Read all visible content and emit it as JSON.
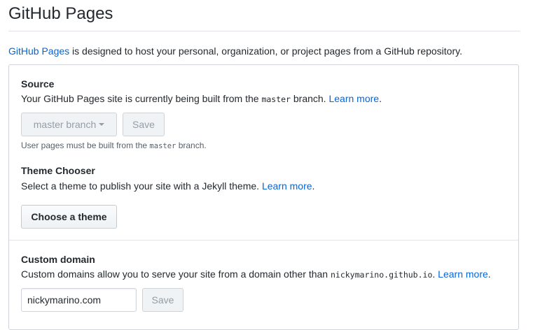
{
  "page": {
    "title": "GitHub Pages"
  },
  "intro": {
    "link": "GitHub Pages",
    "text": " is designed to host your personal, organization, or project pages from a GitHub repository."
  },
  "source": {
    "heading": "Source",
    "desc_before": "Your GitHub Pages site is currently being built from the ",
    "branch_code": "master",
    "desc_after": " branch. ",
    "learn_more": "Learn more",
    "period": ".",
    "branch_select_label": "master branch",
    "save_label": "Save",
    "note_before": "User pages must be built from the ",
    "note_code": "master",
    "note_after": " branch."
  },
  "theme": {
    "heading": "Theme Chooser",
    "desc": "Select a theme to publish your site with a Jekyll theme. ",
    "learn_more": "Learn more",
    "period": ".",
    "button_label": "Choose a theme"
  },
  "custom_domain": {
    "heading": "Custom domain",
    "desc_before": "Custom domains allow you to serve your site from a domain other than ",
    "domain_code": "nickymarino.github.io",
    "desc_after": ". ",
    "learn_more": "Learn more",
    "period": ".",
    "input_value": "nickymarino.com",
    "save_label": "Save"
  },
  "colors": {
    "link": "#0366d6",
    "text": "#24292e",
    "muted": "#586069",
    "border": "#d1d5da",
    "disabled_text": "#959da5"
  }
}
